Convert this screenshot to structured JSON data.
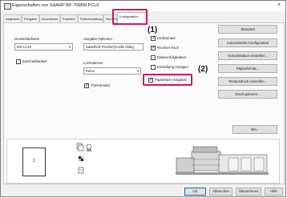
{
  "window": {
    "title": "Eigenschaften von SHARP BP-70M90 PCL6",
    "close_glyph": "×"
  },
  "tabs": [
    "Allgemein",
    "Freigabe",
    "Anschlüsse",
    "Erweitert",
    "Farbverwaltung",
    "Sicherheit",
    "Konfiguration"
  ],
  "config": {
    "druckerlaufwerk_label": "Druckerlaufwerk",
    "druckerlaufwerk_value": "MX-LC10",
    "zuschiessbarkeit_label": "Zuschießbarkeit",
    "ausgabe_label": "Ausgabe-Optionen",
    "ausgabe_value": "Sattelheft-Finisher(Grafik Ablag",
    "lochstanzen_label": "Lochstanzen",
    "lochstanzen_value": "Keine",
    "trimmmodul_label": "Trimmmodul",
    "checkboxes": [
      {
        "label": "Endlosmaer",
        "checked": true
      },
      {
        "label": "Rechner Fach",
        "checked": true
      },
      {
        "label": "Dateiverfolgbarkeit",
        "checked": false
      },
      {
        "label": "Einstellung Ansagen",
        "checked": false
      },
      {
        "label": "Papierfach-Vorgaben",
        "checked": true
      }
    ]
  },
  "buttons": {
    "standard": "Standard",
    "auto_config": "Automatische Konfiguration",
    "schachtstatus": "Schachtstatus einstellen...",
    "papierformat": "Papierformat...",
    "textausdruck": "Textausdruck einstellen...",
    "druckoptionen": "Druckoptionen...",
    "info": "Info..."
  },
  "callouts": {
    "one": "(1)",
    "two": "(2)"
  },
  "preview": {
    "page_number": "1"
  },
  "footer": {
    "ok": "OK",
    "abbrechen": "Abbrechen",
    "uebernehmen": "Übernehmen",
    "hilfe": "Hilfe"
  },
  "colors": {
    "highlight": "#d4145a"
  }
}
